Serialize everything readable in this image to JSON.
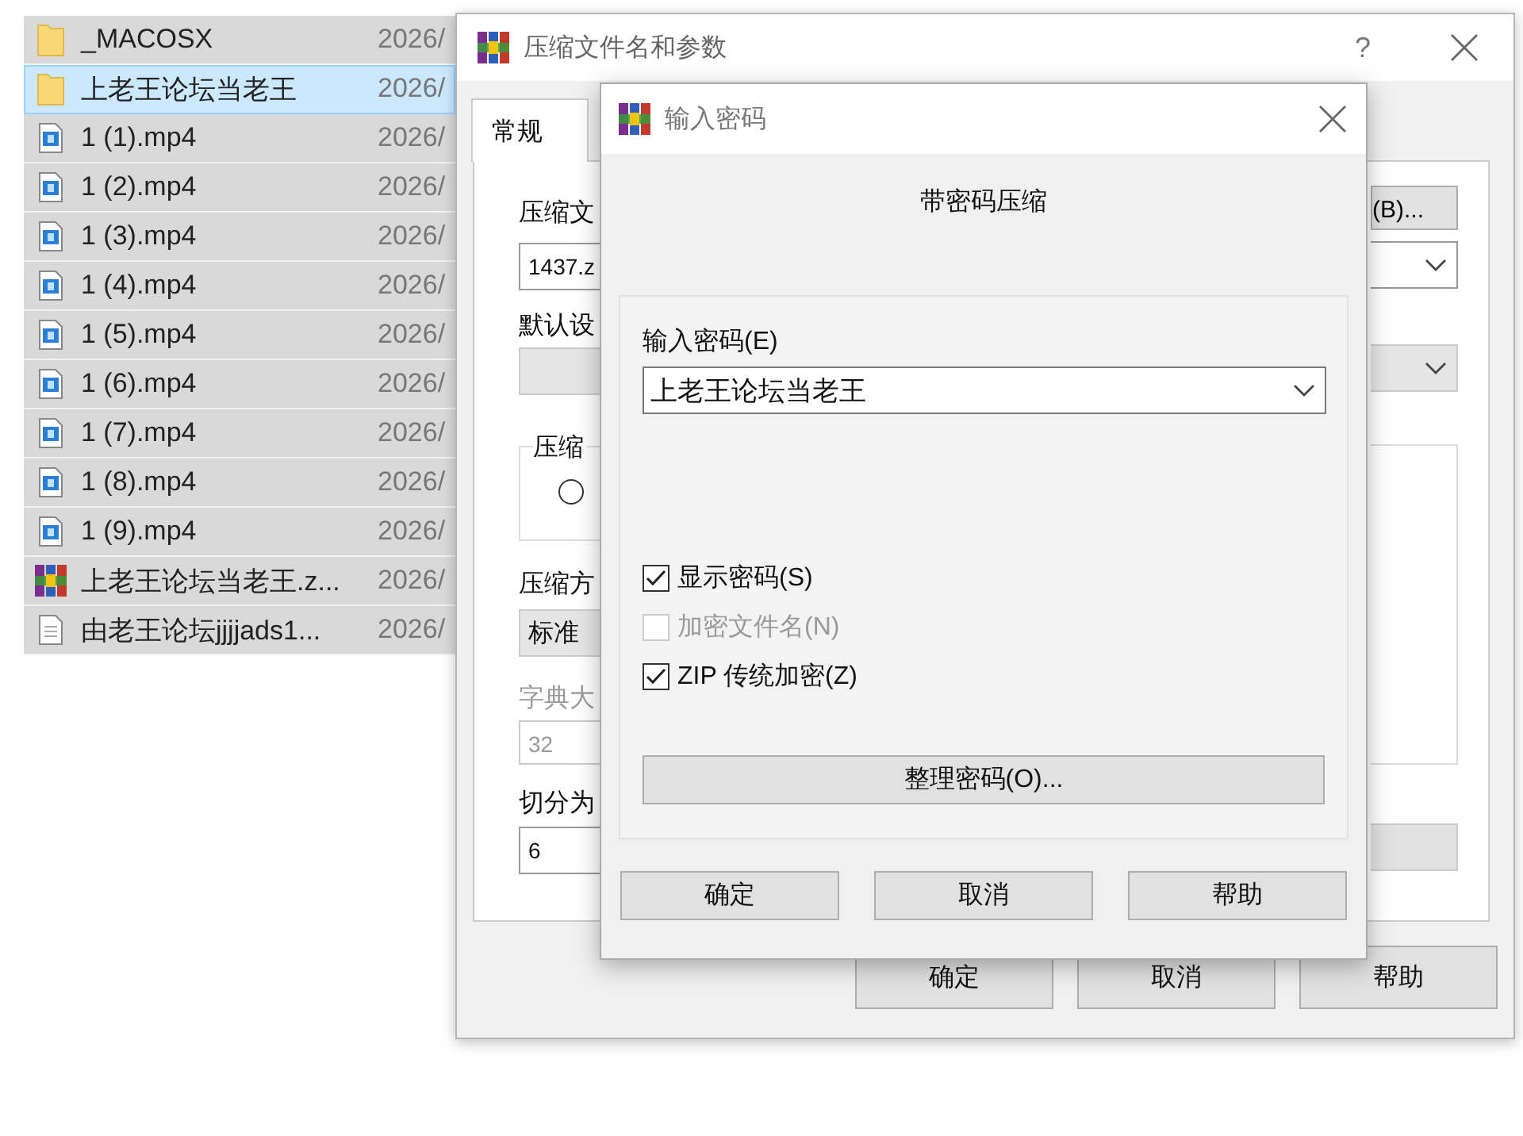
{
  "file_list": {
    "rows": [
      {
        "name": "_MACOSX",
        "date": "2026/",
        "kind": "folder",
        "selected": false
      },
      {
        "name": "上老王论坛当老王",
        "date": "2026/",
        "kind": "folder",
        "selected": true
      },
      {
        "name": "1 (1).mp4",
        "date": "2026/",
        "kind": "video",
        "selected": false
      },
      {
        "name": "1 (2).mp4",
        "date": "2026/",
        "kind": "video",
        "selected": false
      },
      {
        "name": "1 (3).mp4",
        "date": "2026/",
        "kind": "video",
        "selected": false
      },
      {
        "name": "1 (4).mp4",
        "date": "2026/",
        "kind": "video",
        "selected": false
      },
      {
        "name": "1 (5).mp4",
        "date": "2026/",
        "kind": "video",
        "selected": false
      },
      {
        "name": "1 (6).mp4",
        "date": "2026/",
        "kind": "video",
        "selected": false
      },
      {
        "name": "1 (7).mp4",
        "date": "2026/",
        "kind": "video",
        "selected": false
      },
      {
        "name": "1 (8).mp4",
        "date": "2026/",
        "kind": "video",
        "selected": false
      },
      {
        "name": "1 (9).mp4",
        "date": "2026/",
        "kind": "video",
        "selected": false
      },
      {
        "name": "上老王论坛当老王.z...",
        "date": "2026/",
        "kind": "archive",
        "selected": false
      },
      {
        "name": "由老王论坛jjjjads1...",
        "date": "2026/",
        "kind": "text",
        "selected": false
      }
    ]
  },
  "main_dialog": {
    "title": "压缩文件名和参数",
    "help_button": "?",
    "tabs": [
      {
        "label": "常规",
        "selected": true
      }
    ],
    "archive_name": {
      "label": "压缩文",
      "value": "1437.z",
      "browse_button": "(B)..."
    },
    "profile": {
      "label": "默认设"
    },
    "format_group": {
      "label": "压缩",
      "radio_selected": false
    },
    "method": {
      "label": "压缩方",
      "value": "标准"
    },
    "dictionary": {
      "label": "字典大",
      "value": "32",
      "disabled": true
    },
    "split": {
      "label": "切分为",
      "value": "6"
    },
    "buttons": [
      "确定",
      "取消",
      "帮助"
    ]
  },
  "password_dialog": {
    "title": "输入密码",
    "heading": "带密码压缩",
    "password_label": "输入密码(E)",
    "password": "上老王论坛当老王",
    "options": [
      {
        "label": "显示密码(S)",
        "checked": true,
        "disabled": false
      },
      {
        "label": "加密文件名(N)",
        "checked": false,
        "disabled": true
      },
      {
        "label": "ZIP 传统加密(Z)",
        "checked": true,
        "disabled": false
      }
    ],
    "manage_button": "整理密码(O)...",
    "buttons": [
      "确定",
      "取消",
      "帮助"
    ]
  }
}
